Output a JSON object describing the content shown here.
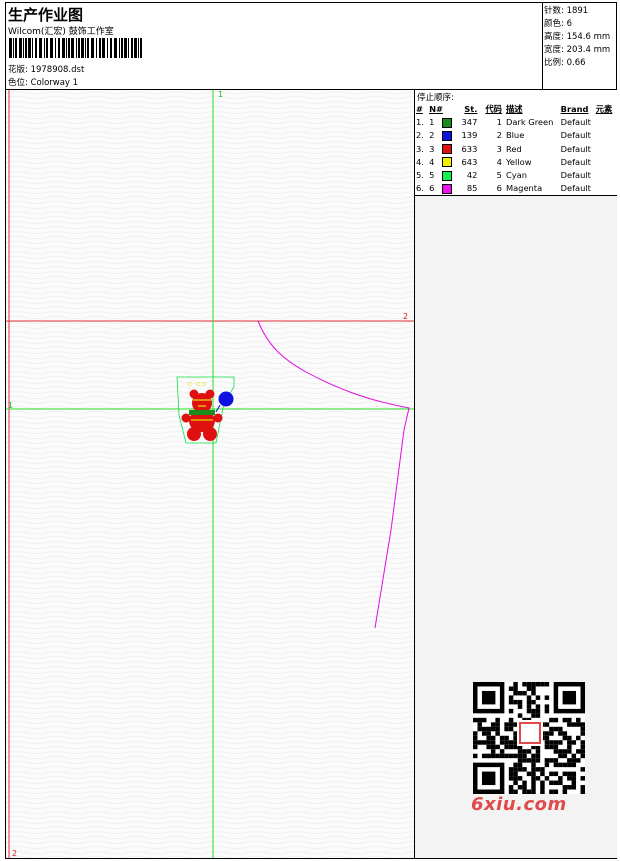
{
  "header": {
    "title": "生产作业图",
    "studio": "Wilcom(汇宏) 鼓饰工作室",
    "design_file_label": "花版:",
    "design_file": "1978908.dst",
    "colorway_label": "色位:",
    "colorway": "Colorway 1"
  },
  "stats": {
    "stitches_label": "针数:",
    "stitches": "1891",
    "colors_label": "颜色:",
    "colors": "6",
    "height_label": "高度:",
    "height": "154.6 mm",
    "width_label": "宽度:",
    "width": "203.4 mm",
    "scale_label": "比例:",
    "scale": "0.66"
  },
  "stop_sequence": {
    "label": "停止顺序:",
    "columns": [
      "#",
      "N#",
      "St.",
      "代码",
      "描述",
      "Brand",
      "元素"
    ],
    "rows": [
      {
        "num": "1.",
        "n": "1",
        "st": "347",
        "code": "1",
        "desc": "Dark Green",
        "brand": "Default",
        "color": "#1a8c1a"
      },
      {
        "num": "2.",
        "n": "2",
        "st": "139",
        "code": "2",
        "desc": "Blue",
        "brand": "Default",
        "color": "#1010e0"
      },
      {
        "num": "3.",
        "n": "3",
        "st": "633",
        "code": "3",
        "desc": "Red",
        "brand": "Default",
        "color": "#e01010"
      },
      {
        "num": "4.",
        "n": "4",
        "st": "643",
        "code": "4",
        "desc": "Yellow",
        "brand": "Default",
        "color": "#f0f000"
      },
      {
        "num": "5.",
        "n": "5",
        "st": "42",
        "code": "5",
        "desc": "Cyan",
        "brand": "Default",
        "color": "#10f050"
      },
      {
        "num": "6.",
        "n": "6",
        "st": "85",
        "code": "6",
        "desc": "Magenta",
        "brand": "Default",
        "color": "#f010f0"
      }
    ]
  },
  "axes": {
    "x1": "1",
    "x2": "2",
    "y1": "1",
    "y2": "2"
  },
  "watermark": {
    "site": "6xiu.com"
  }
}
